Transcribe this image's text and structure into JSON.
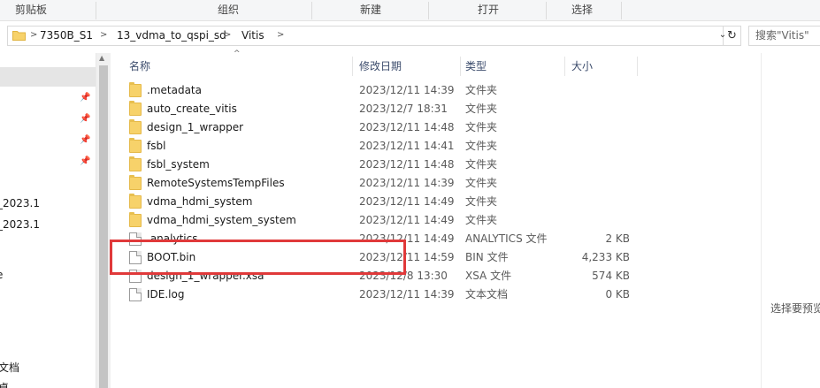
{
  "ribbon": {
    "groups": [
      "剪贴板",
      "组织",
      "新建",
      "打开",
      "选择"
    ]
  },
  "address": {
    "crumbs": [
      "7350B_S1",
      "13_vdma_to_qspi_sd",
      "Vitis"
    ],
    "search_placeholder": "搜索\"Vitis\""
  },
  "nav": {
    "items": [
      "_2023.1",
      "_2023.1",
      "e",
      "文档",
      "桌"
    ]
  },
  "columns": {
    "name": "名称",
    "date": "修改日期",
    "type": "类型",
    "size": "大小"
  },
  "files": [
    {
      "name": ".metadata",
      "date": "2023/12/11 14:39",
      "type": "文件夹",
      "size": "",
      "kind": "folder"
    },
    {
      "name": "auto_create_vitis",
      "date": "2023/12/7 18:31",
      "type": "文件夹",
      "size": "",
      "kind": "folder"
    },
    {
      "name": "design_1_wrapper",
      "date": "2023/12/11 14:48",
      "type": "文件夹",
      "size": "",
      "kind": "folder"
    },
    {
      "name": "fsbl",
      "date": "2023/12/11 14:41",
      "type": "文件夹",
      "size": "",
      "kind": "folder"
    },
    {
      "name": "fsbl_system",
      "date": "2023/12/11 14:48",
      "type": "文件夹",
      "size": "",
      "kind": "folder"
    },
    {
      "name": "RemoteSystemsTempFiles",
      "date": "2023/12/11 14:39",
      "type": "文件夹",
      "size": "",
      "kind": "folder"
    },
    {
      "name": "vdma_hdmi_system",
      "date": "2023/12/11 14:49",
      "type": "文件夹",
      "size": "",
      "kind": "folder"
    },
    {
      "name": "vdma_hdmi_system_system",
      "date": "2023/12/11 14:49",
      "type": "文件夹",
      "size": "",
      "kind": "folder"
    },
    {
      "name": ".analytics",
      "date": "2023/12/11 14:49",
      "type": "ANALYTICS 文件",
      "size": "2 KB",
      "kind": "file"
    },
    {
      "name": "BOOT.bin",
      "date": "2023/12/11 14:59",
      "type": "BIN 文件",
      "size": "4,233 KB",
      "kind": "file"
    },
    {
      "name": "design_1_wrapper.xsa",
      "date": "2023/12/8 13:30",
      "type": "XSA 文件",
      "size": "574 KB",
      "kind": "file"
    },
    {
      "name": "IDE.log",
      "date": "2023/12/11 14:39",
      "type": "文本文档",
      "size": "0 KB",
      "kind": "file"
    }
  ],
  "preview": {
    "text": "选择要预览"
  },
  "colors": {
    "highlight": "#e0393a",
    "folder": "#f7d26a"
  }
}
